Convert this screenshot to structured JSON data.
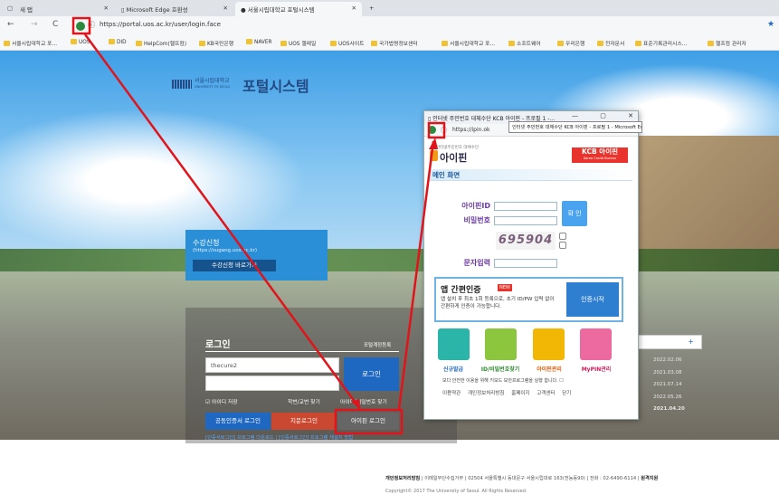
{
  "browser": {
    "tabs": [
      {
        "label": "새 탭"
      },
      {
        "label": "Microsoft Edge 호환성"
      },
      {
        "label": "서울시립대학교 포털시스템"
      }
    ],
    "url": "https://portal.uos.ac.kr/user/login.face",
    "favorites": [
      "서울시립대학교 포...",
      "UOS",
      "DID",
      "HelpCom(헬프컴)",
      "KB국민은행",
      "NAVER",
      "UOS 챌레일",
      "UOS사이트",
      "국가법령정보센터",
      "서울시립대학교 포...",
      "소프트웨어",
      "우리은행",
      "전자문서",
      "표준기록관리시스...",
      "헬프컴 관리자"
    ]
  },
  "portal": {
    "univ_name": "서울시립대학교",
    "univ_en": "UNIVERSITY OF SEOUL",
    "title": "포털시스템",
    "enroll_title": "수강신청",
    "enroll_url": "(https://sugang.uos.ac.kr)",
    "enroll_button": "수강신청 바로가기",
    "login_title": "로그인",
    "account_link": "포털계정등록",
    "id_value": "thecure2",
    "login_button": "로그인",
    "save_id": "아이디 저장",
    "find_pw": "학번/교번 찾기",
    "find_id": "아이디/비밀번호 찾기",
    "cert_login": "공동인증서 로그인",
    "finger_login": "지문로그인",
    "ipin_login": "아이핀 로그인",
    "cert_links": "[인증서로그인] 프로그램 다운로드 | [인증서로그인] 프로그램 재설치 방법",
    "notice_plus": "+",
    "notice_dates": [
      "2022.02.06",
      "2021.03.08",
      "2021.07.14",
      "2022.05.26",
      "2021.04.20"
    ]
  },
  "footer": {
    "line1_bold1": "개인정보처리방침",
    "line1": "| 이메일무단수집거부 | 02504 서울특별시 동대문구 서울시립대로 163(전농동90) | 전화 : 02-6490-6114 |",
    "line1_bold2": "원격지원",
    "line2": "Copyright© 2017 The University of Seoul. All Rights Reserved."
  },
  "popup": {
    "title": "인터넷 주민번호 대체수단 KCB 아이핀 - 프로필 1 -...",
    "controls": "— ▢ ✕",
    "url": "https://ipin.ok",
    "tooltip": "인터넷 주민번호 대체수단 KCB 아이핀 - 프로필 1 - Microsoft Edge",
    "sub": "인터넷주민번호 대체수단",
    "logo": "아이핀",
    "kcb": "KCB 아이핀",
    "kcb_sub": "Korea Credit Bureau",
    "main_screen": "메인 화면",
    "ipin_id_label": "아이핀ID",
    "pw_label": "비밀번호",
    "confirm": "확 인",
    "captcha": "695904",
    "char_label": "문자입력",
    "app_title": "앱 간편인증",
    "app_new": "NEW",
    "app_desc": "앱 설치 후 최초 1회 등록으로, 초기 ID/PW 입력 없이 간편하게 인증이 가능합니다.",
    "app_button": "인증시작",
    "tiles": [
      "신규발급",
      "ID/비밀번호찾기",
      "아이핀관리",
      "MyPIN관리"
    ],
    "check_text": "보다 안전한 이용을 위해 키보드 보안프로그램을 실행 합니다.",
    "links": "이용약관 개인정보처리방침 홈페이지 고객센터 닫기"
  },
  "colors": {
    "annotation_red": "#e0141a",
    "portal_blue": "#1f68c2",
    "kcb_red": "#e8342c"
  }
}
